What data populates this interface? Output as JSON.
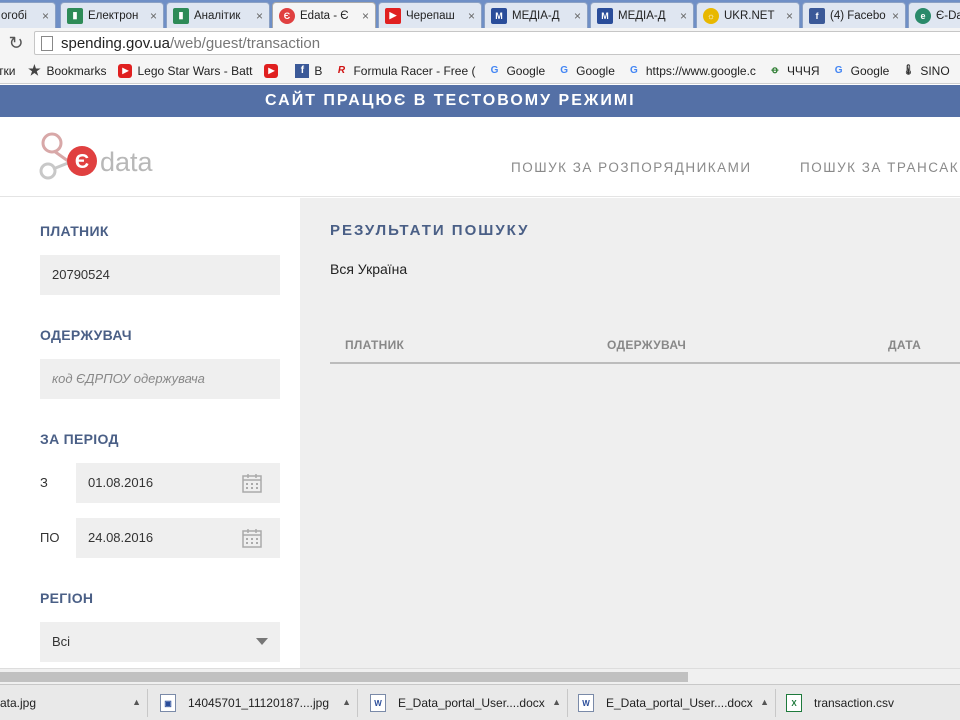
{
  "browser": {
    "tabs": [
      {
        "label": "огобі",
        "icon": "document-icon",
        "color": "#8a8a8a"
      },
      {
        "label": "Електрон",
        "icon": "chart-icon",
        "color": "#2e8b57"
      },
      {
        "label": "Аналітик",
        "icon": "chart-icon",
        "color": "#2e8b57"
      },
      {
        "label": "Edata - Є",
        "icon": "edata-icon",
        "color": "#e04040",
        "active": true
      },
      {
        "label": "Черепаш",
        "icon": "youtube-icon",
        "color": "#e02020"
      },
      {
        "label": "МЕДІА-Д",
        "icon": "media-icon",
        "color": "#2a4d9a"
      },
      {
        "label": "МЕДІА-Д",
        "icon": "media-icon",
        "color": "#2a4d9a"
      },
      {
        "label": "UKR.NET",
        "icon": "ukrnet-icon",
        "color": "#e8b800"
      },
      {
        "label": "(4) Facebo",
        "icon": "facebook-icon",
        "color": "#3b5998"
      },
      {
        "label": "Є-Da",
        "icon": "edata-round-icon",
        "color": "#2a8a6a"
      }
    ],
    "url_host": "spending.gov.ua",
    "url_path": "/web/guest/transaction",
    "bookmarks": [
      {
        "label": "тки",
        "icon": ""
      },
      {
        "label": "Bookmarks",
        "icon": "star-icon"
      },
      {
        "label": "Lego Star Wars - Batt",
        "icon": "youtube-icon"
      },
      {
        "label": "",
        "icon": "youtube-icon"
      },
      {
        "label": "B",
        "icon": "facebook-icon"
      },
      {
        "label": "Formula Racer - Free (",
        "icon": "racer-icon"
      },
      {
        "label": "Google",
        "icon": "google-icon"
      },
      {
        "label": "Google",
        "icon": "google-icon"
      },
      {
        "label": "https://www.google.c",
        "icon": "google-icon"
      },
      {
        "label": "ЧЧЧЯ",
        "icon": "ua-icon"
      },
      {
        "label": "Google",
        "icon": "google-icon"
      },
      {
        "label": "SINO",
        "icon": "thermometer-icon"
      }
    ]
  },
  "banner": {
    "text": "САЙТ ПРАЦЮЄ В ТЕСТОВОМУ РЕЖИМІ"
  },
  "header": {
    "logo_letter": "Є",
    "logo_text": "data",
    "nav": [
      {
        "label": "ПОШУК ЗА РОЗПОРЯДНИКАМИ"
      },
      {
        "label": "ПОШУК ЗА ТРАНСАК"
      }
    ]
  },
  "filters": {
    "payer_label": "ПЛАТНИК",
    "payer_value": "20790524",
    "recipient_label": "ОДЕРЖУВАЧ",
    "recipient_placeholder": "код ЄДРПОУ одержувача",
    "period_label": "ЗА ПЕРІОД",
    "from_label": "З",
    "from_value": "01.08.2016",
    "to_label": "ПО",
    "to_value": "24.08.2016",
    "region_label": "РЕГІОН",
    "region_value": "Всі"
  },
  "results": {
    "title": "РЕЗУЛЬТАТИ ПОШУКУ",
    "subtitle": "Вся Україна",
    "columns": [
      "ПЛАТНИК",
      "ОДЕРЖУВАЧ",
      "ДАТА"
    ]
  },
  "downloads": [
    {
      "label": "ata.jpg",
      "icon": "image-icon"
    },
    {
      "label": "14045701_11120187....jpg",
      "icon": "image-icon"
    },
    {
      "label": "E_Data_portal_User....docx",
      "icon": "word-icon"
    },
    {
      "label": "E_Data_portal_User....docx",
      "icon": "word-icon"
    },
    {
      "label": "transaction.csv",
      "icon": "excel-icon"
    }
  ],
  "colors": {
    "banner": "#5470a6",
    "accent_red": "#e04040",
    "label_blue": "#4a5f86"
  }
}
